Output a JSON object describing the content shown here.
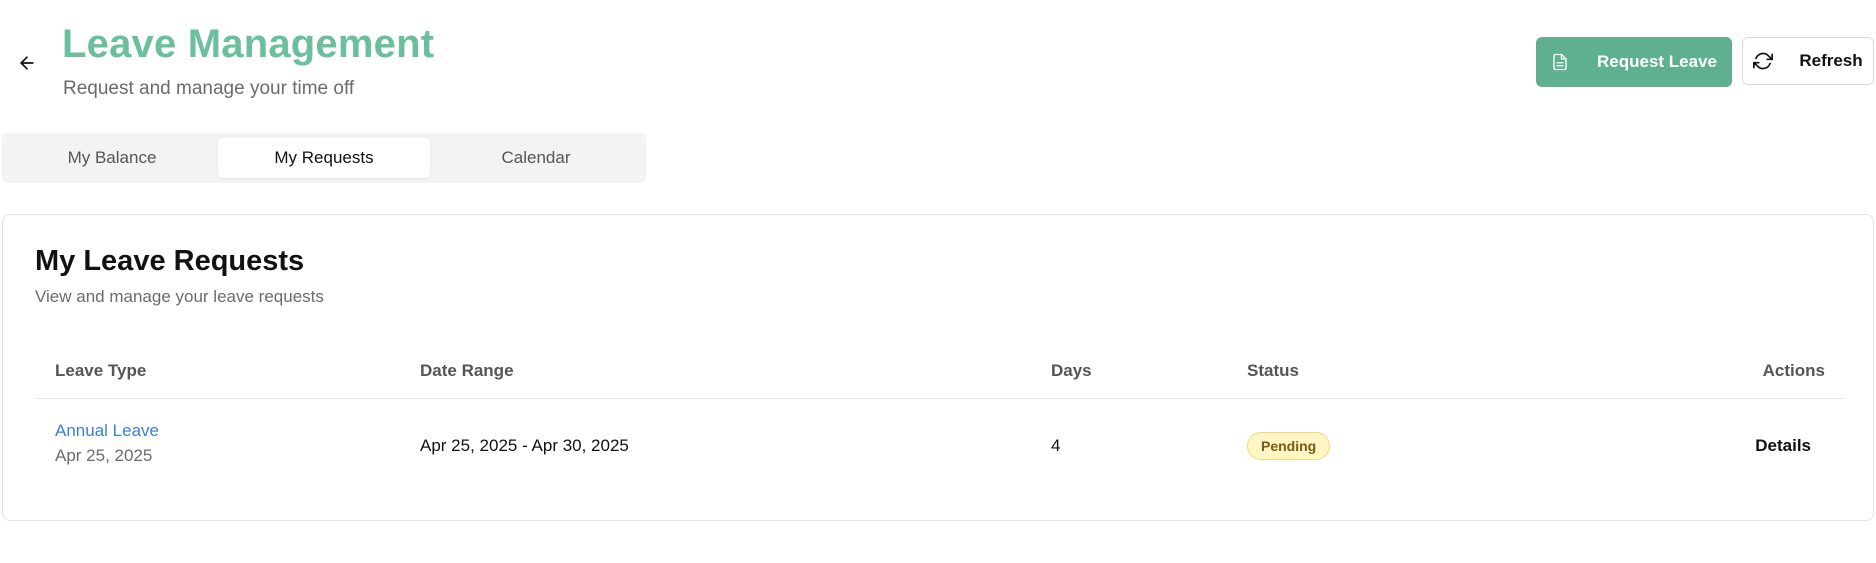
{
  "header": {
    "title": "Leave Management",
    "subtitle": "Request and manage your time off",
    "back_icon": "arrow-left-icon",
    "title_color": "#6bbf9c"
  },
  "actions": {
    "request_leave_label": "Request Leave",
    "request_leave_icon": "document-icon",
    "refresh_label": "Refresh",
    "refresh_icon": "refresh-icon",
    "primary_color": "#5fb08f"
  },
  "tabs": [
    {
      "label": "My Balance",
      "active": false
    },
    {
      "label": "My Requests",
      "active": true
    },
    {
      "label": "Calendar",
      "active": false
    }
  ],
  "requests_card": {
    "title": "My Leave Requests",
    "subtitle": "View and manage your leave requests",
    "columns": {
      "leave_type": "Leave Type",
      "date_range": "Date Range",
      "days": "Days",
      "status": "Status",
      "actions": "Actions"
    },
    "rows": [
      {
        "leave_type": "Annual Leave",
        "submitted": "Apr 25, 2025",
        "date_range": "Apr 25, 2025 - Apr 30, 2025",
        "days": "4",
        "status": "Pending",
        "action": "Details"
      }
    ]
  }
}
